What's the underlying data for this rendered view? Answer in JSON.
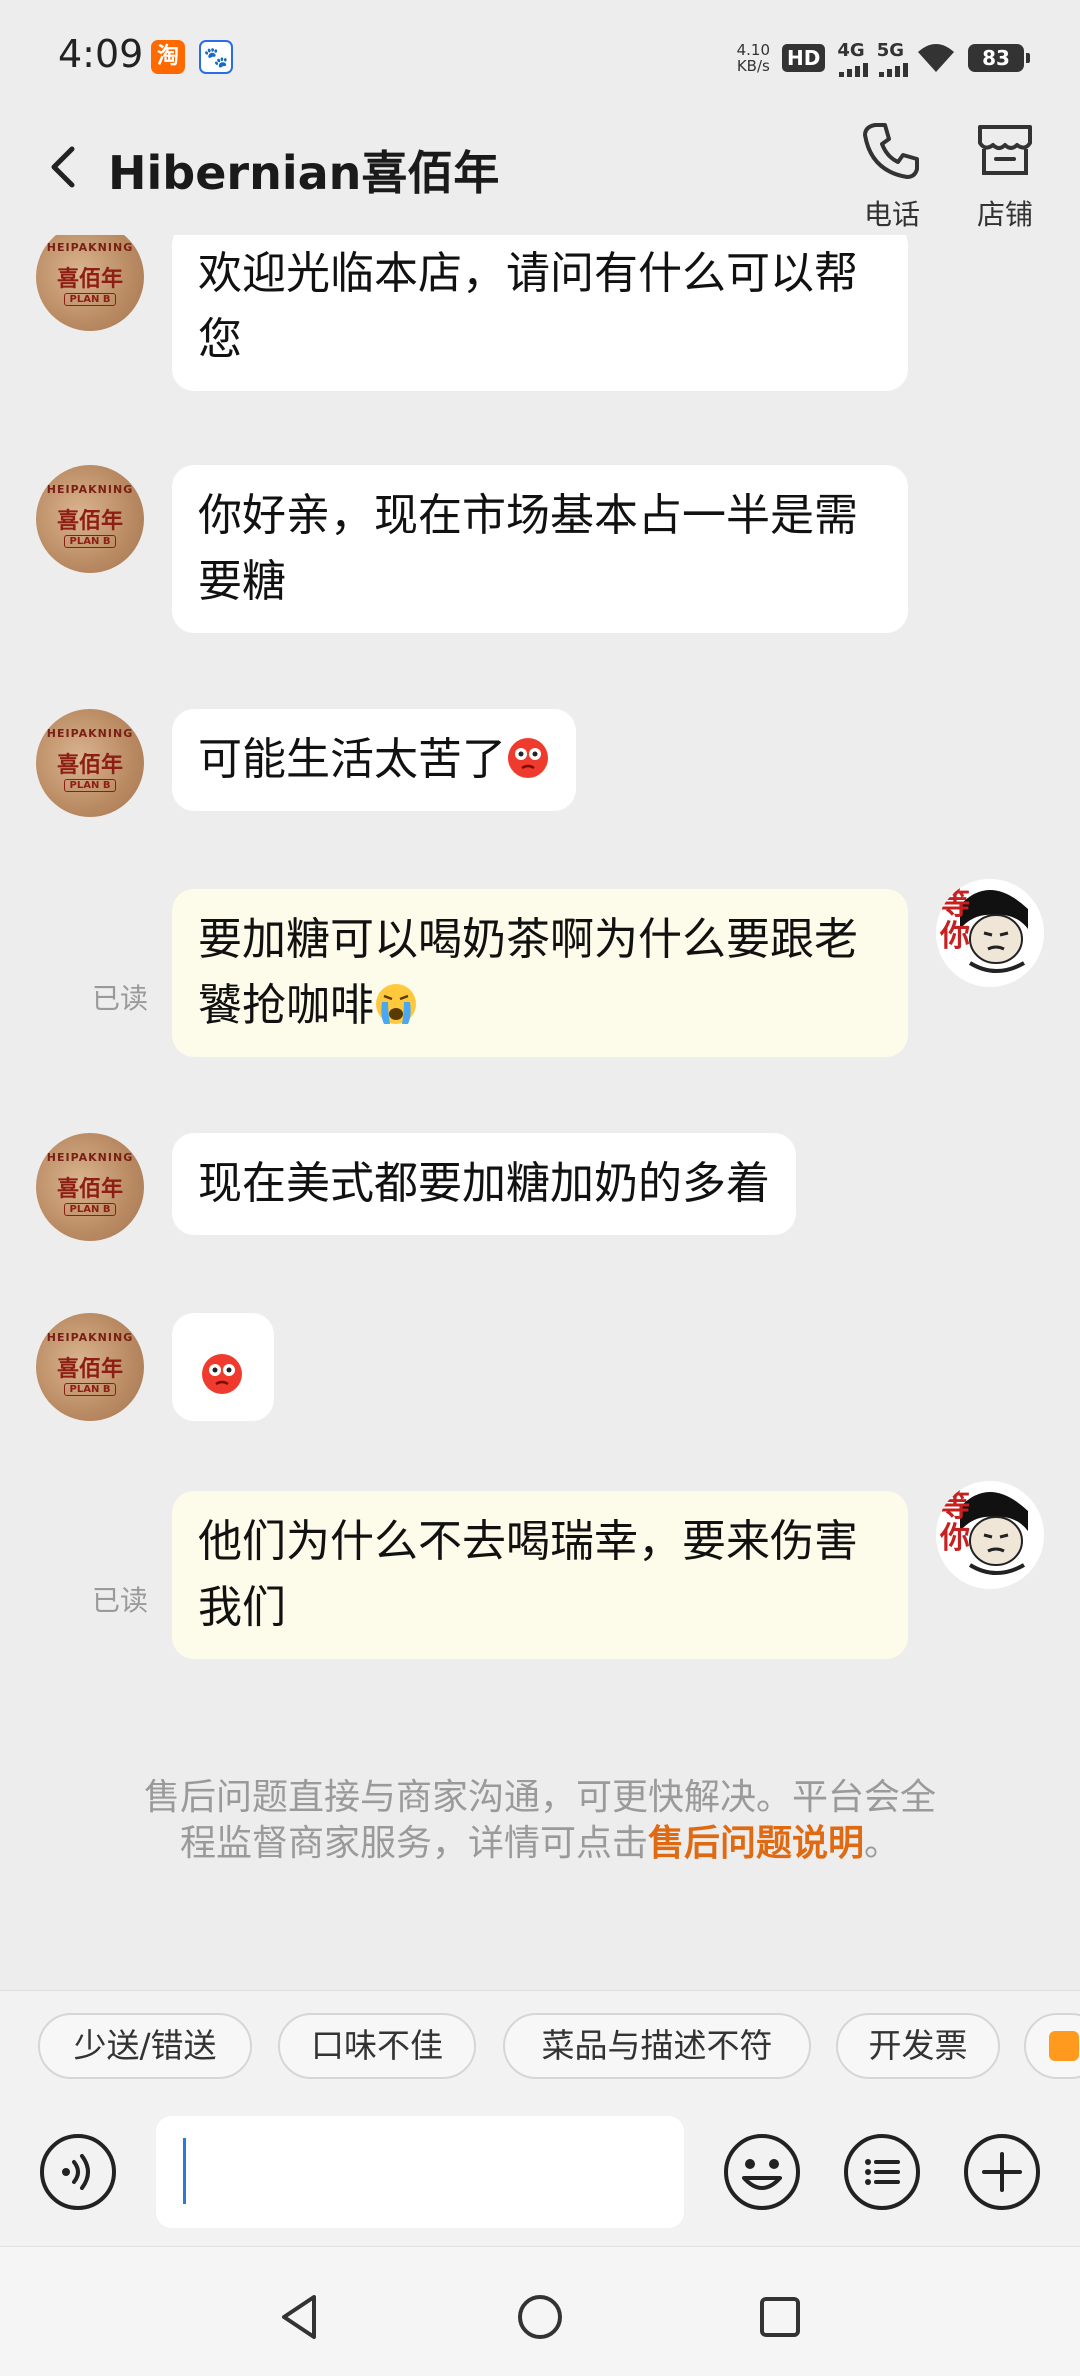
{
  "status_bar": {
    "time": "4:09",
    "speed_value": "4.10",
    "speed_unit": "KB/s",
    "hd": "HD",
    "net1": "4G",
    "net2": "5G",
    "battery": "83"
  },
  "header": {
    "title": "Hibernian喜佰年",
    "phone_label": "电话",
    "shop_label": "店铺"
  },
  "merchant_avatar": {
    "line1": "HEIPAKNING",
    "line2": "喜佰年",
    "line3": "PLAN B"
  },
  "user_avatar_text": "等你",
  "messages": [
    {
      "from": "merchant",
      "text": "欢迎光临本店，请问有什么可以帮您"
    },
    {
      "from": "merchant",
      "text": "你好亲，现在市场基本占一半是需要糖"
    },
    {
      "from": "merchant",
      "text": "可能生活太苦了",
      "emoji": "flushed-face"
    },
    {
      "from": "user",
      "text": "要加糖可以喝奶茶啊为什么要跟老饕抢咖啡",
      "emoji": "crying-face",
      "status": "已读"
    },
    {
      "from": "merchant",
      "text": "现在美式都要加糖加奶的多着"
    },
    {
      "from": "merchant",
      "text": "",
      "emoji": "flushed-face"
    },
    {
      "from": "user",
      "text": "他们为什么不去喝瑞幸，要来伤害我们",
      "status": "已读"
    }
  ],
  "notice": {
    "text": "售后问题直接与商家沟通，可更快解决。平台会全程监督商家服务，详情可点击",
    "link": "售后问题说明",
    "tail": "。"
  },
  "quick_replies": [
    "少送/错送",
    "口味不佳",
    "菜品与描述不符",
    "开发票"
  ],
  "input": {
    "value": "",
    "placeholder": ""
  },
  "colors": {
    "background": "#ededed",
    "merchant_bubble": "#ffffff",
    "user_bubble": "#fdfbea",
    "link": "#e06a12"
  }
}
